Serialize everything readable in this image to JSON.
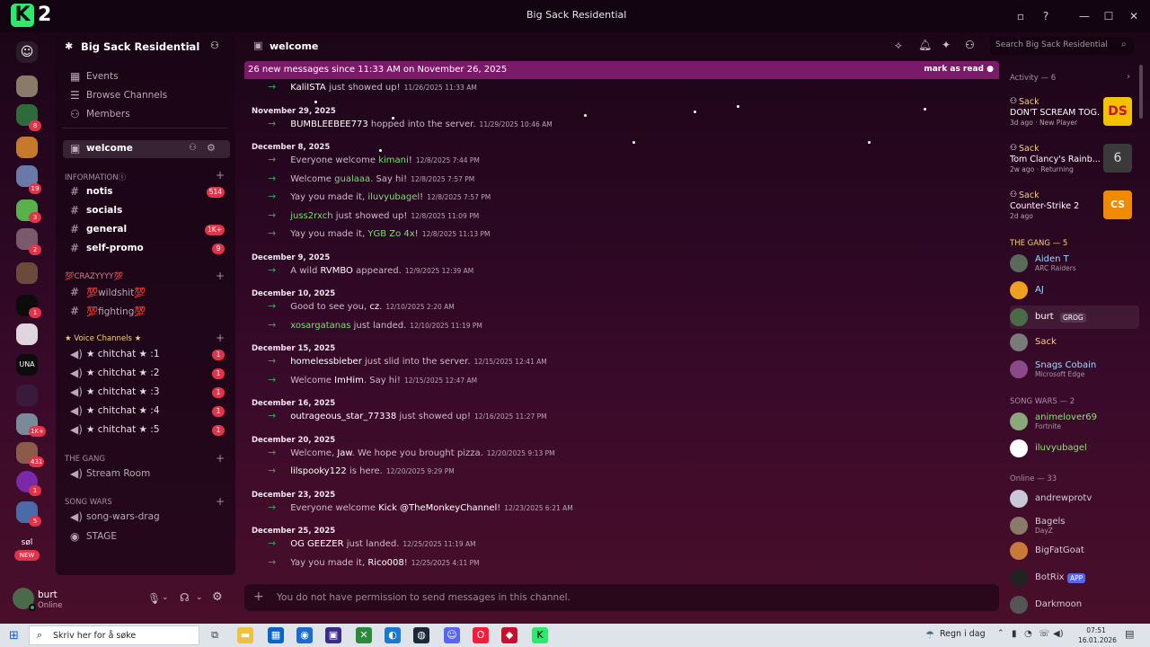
{
  "window": {
    "app_logo_letter": "K",
    "app_logo_number": "2",
    "title": "Big Sack Residential",
    "controls": [
      "▫",
      "?",
      "—",
      "☐",
      "✕"
    ]
  },
  "rail": {
    "badges": [
      "8",
      "19",
      "3",
      "2",
      "1",
      "1K+",
      "431",
      "1",
      "5"
    ],
    "new_label": "NEW",
    "sol_label": "søl",
    "una_label": "UNA"
  },
  "sidebar": {
    "server_name": "Big Sack Residential",
    "top_items": [
      {
        "label": "Events"
      },
      {
        "label": "Browse Channels"
      },
      {
        "label": "Members"
      }
    ],
    "selected_channel": "welcome",
    "categories": [
      {
        "label": "INFORMATIONⓘ",
        "channels": [
          {
            "label": "notis",
            "badge": "514"
          },
          {
            "label": "socials",
            "badge": ""
          },
          {
            "label": "general",
            "badge": "1K+"
          },
          {
            "label": "self-promo",
            "badge": "9"
          }
        ]
      },
      {
        "label": "💯CRAZYYYY💯",
        "channels": [
          {
            "label": "💯wildshit💯",
            "badge": ""
          },
          {
            "label": "💯fighting💯",
            "badge": ""
          }
        ]
      },
      {
        "label": "★ Voice Channels ★",
        "channels": [
          {
            "label": "★ chitchat ★ :1",
            "badge": "1"
          },
          {
            "label": "★ chitchat ★ :2",
            "badge": "1"
          },
          {
            "label": "★ chitchat ★ :3",
            "badge": "1"
          },
          {
            "label": "★ chitchat ★ :4",
            "badge": "1"
          },
          {
            "label": "★ chitchat ★ :5",
            "badge": "1"
          }
        ]
      },
      {
        "label": "THE GANG",
        "channels": [
          {
            "label": "Stream Room",
            "badge": ""
          }
        ]
      },
      {
        "label": "SONG WARS",
        "channels": [
          {
            "label": "song-wars-drag",
            "badge": ""
          },
          {
            "label": "STAGE",
            "badge": ""
          }
        ]
      }
    ]
  },
  "user": {
    "name": "burt",
    "status": "Online"
  },
  "chat": {
    "channel_title": "welcome",
    "search_placeholder": "Search Big Sack Residential",
    "new_messages_banner": "26 new messages since 11:33 AM on November 26, 2025",
    "mark_as_read": "mark as read",
    "composer_placeholder": "You do not have permission to send messages in this channel.",
    "entries": [
      {
        "type": "msg",
        "pre": "",
        "name": "KaliISTA",
        "post": " just showed up!",
        "time": "11/26/2025 11:33 AM"
      },
      {
        "type": "date",
        "text": "November 29, 2025"
      },
      {
        "type": "msg",
        "pre": "",
        "name": "BUMBLEEBEE773",
        "post": " hopped into the server.",
        "time": "11/29/2025 10:46 AM"
      },
      {
        "type": "date",
        "text": "December 8, 2025"
      },
      {
        "type": "msg",
        "pre": "Everyone welcome ",
        "name": "kimani",
        "post": "!",
        "time": "12/8/2025 7:44 PM",
        "green": true
      },
      {
        "type": "msg",
        "pre": "Welcome ",
        "name": "gualaaa",
        "post": ". Say hi!",
        "time": "12/8/2025 7:57 PM",
        "green": true
      },
      {
        "type": "msg",
        "pre": "Yay you made it, ",
        "name": "iluvyubagel",
        "post": "!",
        "time": "12/8/2025 7:57 PM",
        "green": true
      },
      {
        "type": "msg",
        "pre": "",
        "name": "juss2rxch",
        "post": " just showed up!",
        "time": "12/8/2025 11:09 PM",
        "green": true
      },
      {
        "type": "msg",
        "pre": "Yay you made it, ",
        "name": "YGB Zo 4x",
        "post": "!",
        "time": "12/8/2025 11:13 PM",
        "green": true
      },
      {
        "type": "date",
        "text": "December 9, 2025"
      },
      {
        "type": "msg",
        "pre": "A wild ",
        "name": "RVMBO",
        "post": " appeared.",
        "time": "12/9/2025 12:39 AM"
      },
      {
        "type": "date",
        "text": "December 10, 2025"
      },
      {
        "type": "msg",
        "pre": "Good to see you, ",
        "name": "cz",
        "post": ".",
        "time": "12/10/2025 2:20 AM"
      },
      {
        "type": "msg",
        "pre": "",
        "name": "xosargatanas",
        "post": " just landed.",
        "time": "12/10/2025 11:19 PM",
        "green": true
      },
      {
        "type": "date",
        "text": "December 15, 2025"
      },
      {
        "type": "msg",
        "pre": "",
        "name": "homelessbieber",
        "post": " just slid into the server.",
        "time": "12/15/2025 12:41 AM"
      },
      {
        "type": "msg",
        "pre": "Welcome ",
        "name": "ImHim",
        "post": ". Say hi!",
        "time": "12/15/2025 12:47 AM"
      },
      {
        "type": "date",
        "text": "December 16, 2025"
      },
      {
        "type": "msg",
        "pre": "",
        "name": "outrageous_star_77338",
        "post": " just showed up!",
        "time": "12/16/2025 11:27 PM"
      },
      {
        "type": "date",
        "text": "December 20, 2025"
      },
      {
        "type": "msg",
        "pre": "Welcome, ",
        "name": "Jaw",
        "post": ". We hope you brought pizza.",
        "time": "12/20/2025 9:13 PM"
      },
      {
        "type": "msg",
        "pre": "",
        "name": "lilspooky122",
        "post": " is here.",
        "time": "12/20/2025 9:29 PM"
      },
      {
        "type": "date",
        "text": "December 23, 2025"
      },
      {
        "type": "msg",
        "pre": "Everyone welcome ",
        "name": "Kick @TheMonkeyChannel",
        "post": "!",
        "time": "12/23/2025 6:21 AM"
      },
      {
        "type": "date",
        "text": "December 25, 2025"
      },
      {
        "type": "msg",
        "pre": "",
        "name": "OG GEEZER",
        "post": " just landed.",
        "time": "12/25/2025 11:19 AM"
      },
      {
        "type": "msg",
        "pre": "Yay you made it, ",
        "name": "Rico008",
        "post": "!",
        "time": "12/25/2025 4:11 PM"
      }
    ]
  },
  "members": {
    "activity_header": "Activity — 6",
    "activities": [
      {
        "user": "Sack",
        "title": "DON'T SCREAM TOG...",
        "sub": "3d ago · New Player",
        "thumb_text": "DS",
        "thumb_color": "#f2c200"
      },
      {
        "user": "Sack",
        "title": "Tom Clancy's Rainb...",
        "sub": "2w ago · Returning",
        "thumb_text": "6",
        "thumb_color": "#3a3a3a"
      },
      {
        "user": "Sack",
        "title": "Counter-Strike 2",
        "sub": "2d ago",
        "thumb_text": "CS",
        "thumb_color": "#f08a00"
      }
    ],
    "sections": [
      {
        "label": "THE GANG — 5",
        "members": [
          {
            "name": "Aiden T",
            "sub": "ARC Raiders",
            "color": "#a9d8ff"
          },
          {
            "name": "AJ",
            "sub": "",
            "color": "#a9d8ff"
          },
          {
            "name": "burt",
            "sub": "",
            "tag": "GROG",
            "color": "#ffffff"
          },
          {
            "name": "Sack",
            "sub": "",
            "color": "#f5d27a"
          },
          {
            "name": "Snags Cobain",
            "sub": "Microsoft Edge",
            "color": "#a9d8ff"
          }
        ]
      },
      {
        "label": "SONG WARS — 2",
        "members": [
          {
            "name": "animelover69",
            "sub": "Fortnite",
            "color": "#8fe37c"
          },
          {
            "name": "iluvyubagel",
            "sub": "",
            "color": "#8fe37c"
          }
        ]
      },
      {
        "label": "Online — 33",
        "members": [
          {
            "name": "andrewprotv",
            "sub": "",
            "color": "#d9c9d5"
          },
          {
            "name": "Bagels",
            "sub": "DayZ",
            "color": "#d9c9d5"
          },
          {
            "name": "BigFatGoat",
            "sub": "",
            "color": "#d9c9d5"
          },
          {
            "name": "BotRix",
            "sub": "",
            "tag": "APP",
            "color": "#d9c9d5"
          },
          {
            "name": "Darkmoon",
            "sub": "",
            "color": "#d9c9d5"
          }
        ]
      }
    ]
  },
  "taskbar": {
    "search_placeholder": "Skriv her for å søke",
    "weather": "Regn i dag",
    "time": "07:51",
    "date": "16.01.2026"
  },
  "colors": {
    "accent_banner": "#7a1a68",
    "badge": "#e0344a",
    "online_green": "#3ba55c",
    "k2_green": "#2dea6f"
  }
}
